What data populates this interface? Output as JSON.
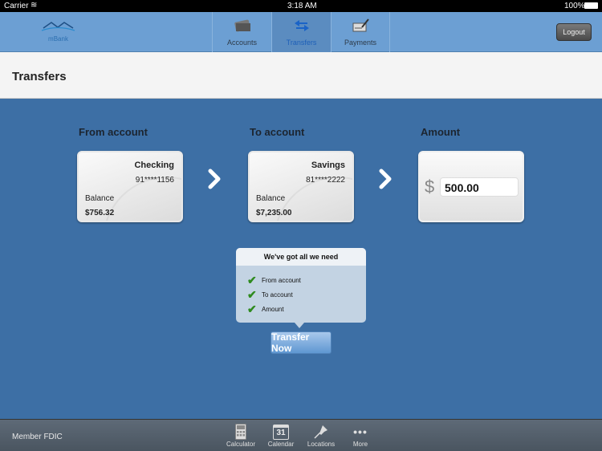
{
  "status": {
    "carrier": "Carrier",
    "time": "3:18 AM",
    "battery": "100%"
  },
  "header": {
    "logo": "mBank",
    "tabs": [
      {
        "label": "Accounts",
        "icon": "credit-card-icon"
      },
      {
        "label": "Transfers",
        "icon": "transfer-arrows-icon",
        "active": true
      },
      {
        "label": "Payments",
        "icon": "check-pen-icon"
      }
    ],
    "logout": "Logout"
  },
  "page": {
    "title": "Transfers"
  },
  "from": {
    "heading": "From account",
    "name": "Checking",
    "number": "91****1156",
    "balance_label": "Balance",
    "balance": "$756.32"
  },
  "to": {
    "heading": "To account",
    "name": "Savings",
    "number": "81****2222",
    "balance_label": "Balance",
    "balance": "$7,235.00"
  },
  "amount": {
    "heading": "Amount",
    "currency": "$",
    "value": "500.00"
  },
  "checklist": {
    "title": "We've got all we need",
    "items": [
      "From account",
      "To account",
      "Amount"
    ]
  },
  "transfer_button": "Transfer Now",
  "footer": {
    "fdic": "Member FDIC",
    "items": [
      {
        "label": "Calculator"
      },
      {
        "label": "Calendar",
        "day": "31"
      },
      {
        "label": "Locations"
      },
      {
        "label": "More"
      }
    ]
  },
  "colors": {
    "header": "#6c9fd3",
    "main": "#3d6fa5",
    "active_tab": "#5b8cc0",
    "check": "#2e8a1e"
  }
}
